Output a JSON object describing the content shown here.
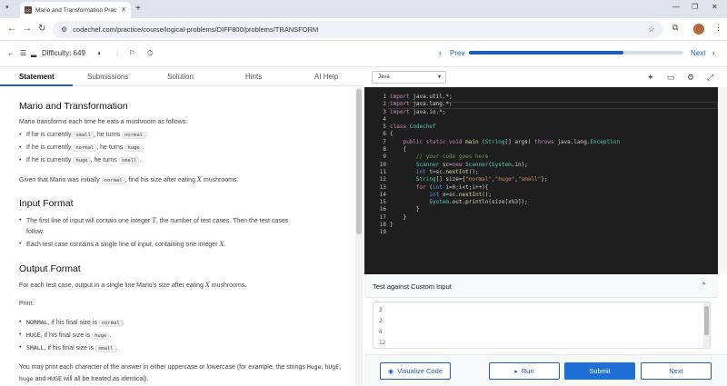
{
  "browser": {
    "tab_title": "Mario and Transformation Prac",
    "favicon_text": "CC",
    "url": "codechef.com/practice/course/logical-problems/DIFF800/problems/TRANSFORM"
  },
  "header": {
    "difficulty_label": "Difficulty:",
    "difficulty_value": "649",
    "prev_label": "Prev",
    "next_label": "Next",
    "progress": 0.72
  },
  "tabs": [
    {
      "label": "Statement"
    },
    {
      "label": "Submissions"
    },
    {
      "label": "Solution"
    },
    {
      "label": "Hints"
    },
    {
      "label": "AI Help"
    }
  ],
  "statement": {
    "title": "Mario and Transformation",
    "intro": "Mario transforms each time he eats a mushroom as follows:",
    "rules": [
      {
        "a": "If he is currently",
        "from": "small",
        "b": ", he turns",
        "to": "normal"
      },
      {
        "a": "If he is currently",
        "from": "normal",
        "b": ", he turns",
        "to": "huge"
      },
      {
        "a": "If he is currently",
        "from": "huge",
        "b": ", he turns",
        "to": "small"
      }
    ],
    "given_a": "Given that Mario was initially",
    "given_code": "normal",
    "given_b": ", find his size after eating",
    "given_var": "X",
    "given_c": "mushrooms.",
    "input_title": "Input Format",
    "input_1a": "The first line of input will contain one integer",
    "input_1var": "T",
    "input_1b": ", the number of test cases. Then the test cases",
    "input_1c": "follow.",
    "input_2a": "Each test case contains a single line of input, containing one integer",
    "input_2var": "X",
    "output_title": "Output Format",
    "output_a": "For each test case, output in a single line Mario's size after eating",
    "output_var": "X",
    "output_b": "mushrooms.",
    "print_label": "Print:",
    "prints": [
      {
        "word": "NORMAL",
        "a": ", if his final size is",
        "code": "normal"
      },
      {
        "word": "HUGE",
        "a": ", if his final size is",
        "code": "huge"
      },
      {
        "word": "SMALL",
        "a": ", if his final size is",
        "code": "small"
      }
    ],
    "case_a": "You may print each character of the answer in either uppercase or lowercase (for example, the strings",
    "case_words": [
      "Huge",
      "hUgE",
      "huge",
      "HUGE"
    ],
    "case_and": "and",
    "case_b": "will all be treated as identical)."
  },
  "editor": {
    "language": "Java",
    "line_numbers": [
      "1",
      "2",
      "3",
      "4",
      "5",
      "6",
      "7",
      "8",
      "9",
      "10",
      "11",
      "12",
      "13",
      "14",
      "15",
      "16",
      "17",
      "18",
      "19"
    ]
  },
  "test_panel": {
    "title": "Test against Custom Input",
    "values": [
      "3",
      "2",
      "4",
      "12"
    ]
  },
  "buttons": {
    "visualize": "Visualize Code",
    "run": "Run",
    "submit": "Submit",
    "next": "Next"
  },
  "colors": {
    "accent": "#1f5eb8",
    "editor_bg": "#1e1e1e"
  }
}
